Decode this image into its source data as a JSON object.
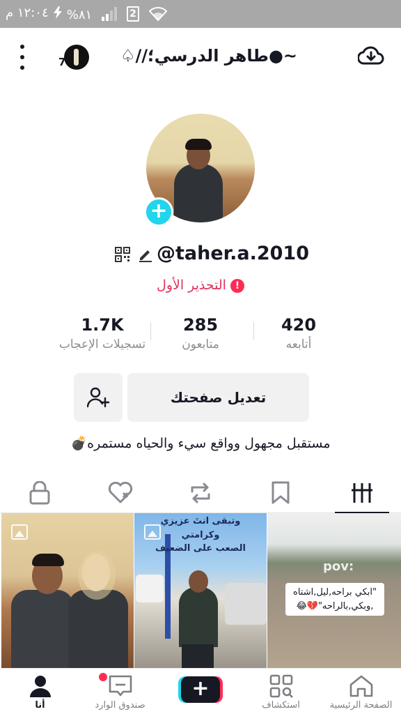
{
  "status_bar": {
    "time": "١٢:٠٤ م",
    "battery": "%٨١",
    "sim_label": "2"
  },
  "header": {
    "title": "~●طاهر الدرسي؛//♤",
    "story_count": "7"
  },
  "profile": {
    "username": "@taher.a.2010",
    "warning": "التحذير الأول",
    "warning_mark": "!",
    "bio": "مستقبل مجهول وواقع سيء والحياه مستمره💣"
  },
  "stats": {
    "following": {
      "value": "420",
      "label": "أتابعه"
    },
    "followers": {
      "value": "285",
      "label": "متابعون"
    },
    "likes": {
      "value": "1.7K",
      "label": "تسجيلات الإعجاب"
    }
  },
  "buttons": {
    "edit_profile": "تعديل صفحتك",
    "create": "+"
  },
  "tabs": [
    "videos-grid",
    "saved",
    "reposts",
    "liked",
    "private"
  ],
  "grid": {
    "video2_overlay": "وتبقى انتَ عزيزي\nوكرامتي\nالصعب على الضعيف",
    "video3_pov": "pov:",
    "video3_caption": "\"ابكي براحه,ليل,اشتاه\n,وبكي,بالراحه\"💔😂"
  },
  "bottom_nav": {
    "home": "الصفحة الرئيسية",
    "discover": "استكشاف",
    "inbox": "صندوق الوارد",
    "me": "أنا"
  },
  "colors": {
    "accent_red": "#fe2c55",
    "accent_cyan": "#20d5ec",
    "warning": "#e0335c"
  }
}
